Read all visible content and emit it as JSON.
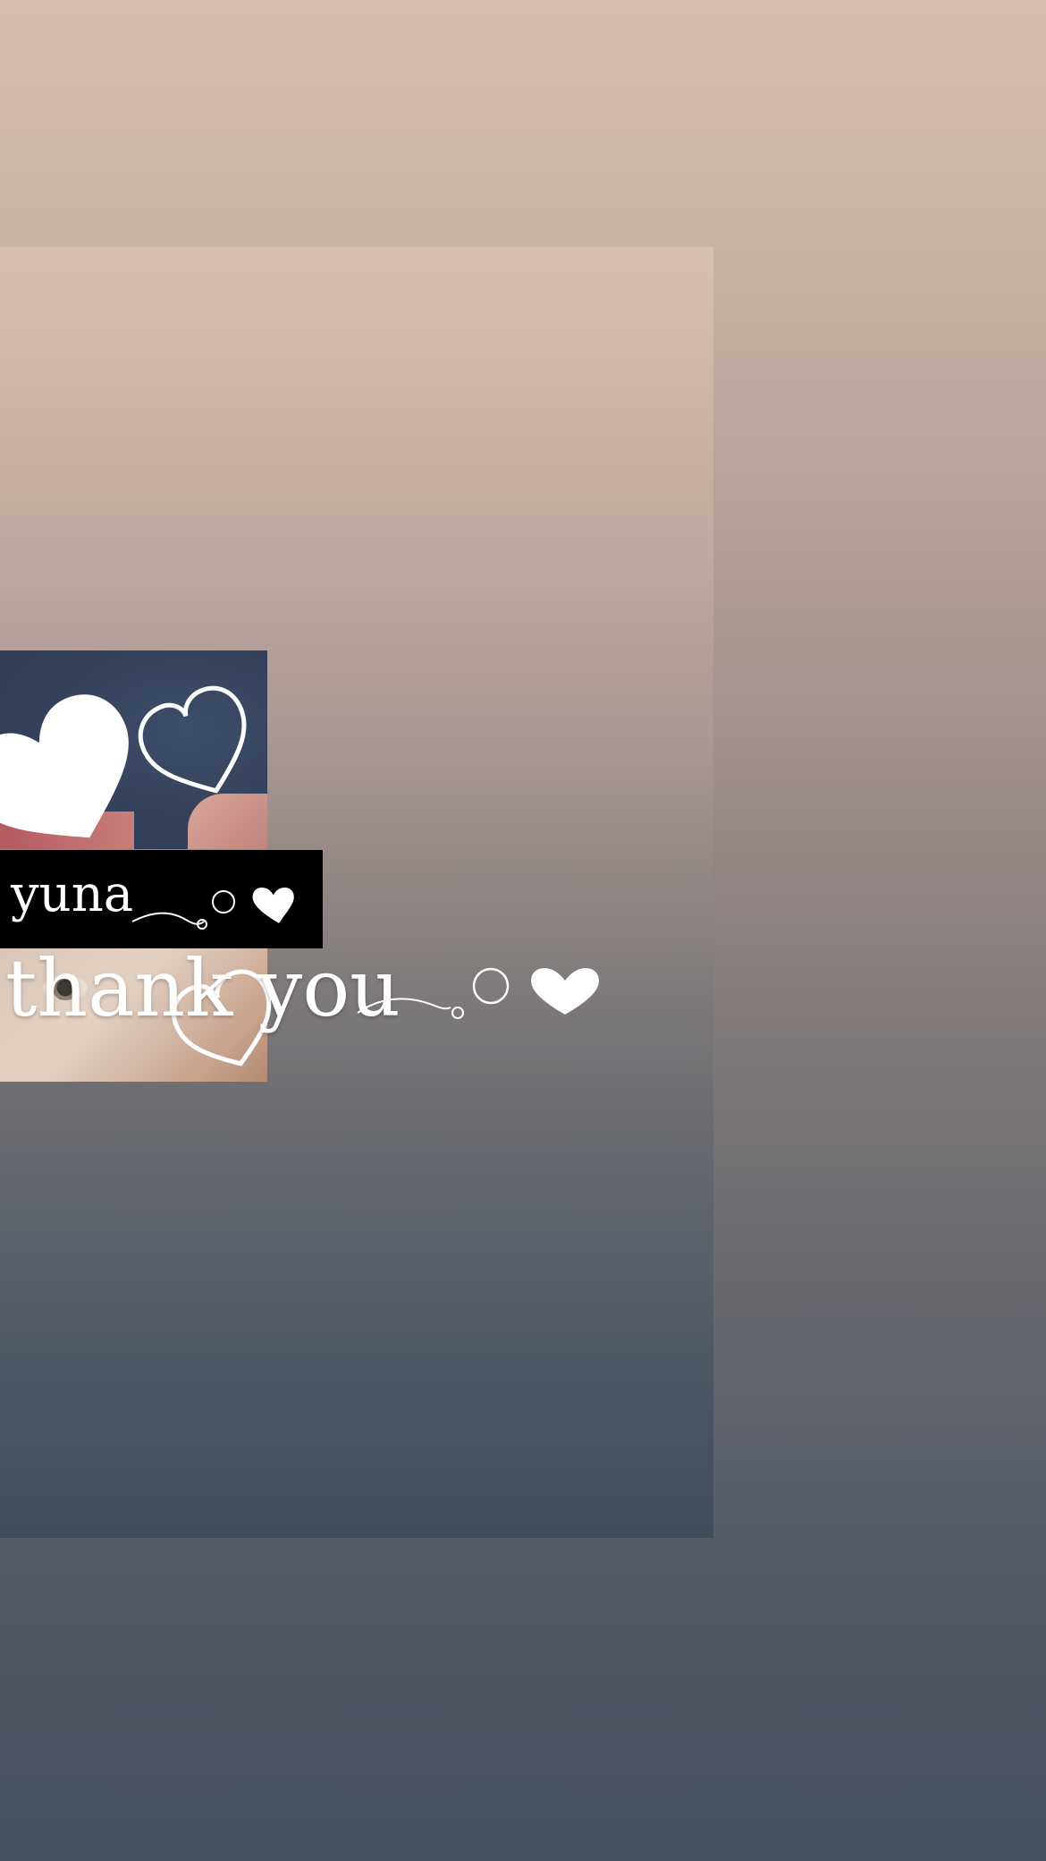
{
  "sticker": {
    "name_text": "yuna",
    "thanks_text": "thank you",
    "icons": [
      "heart-icon",
      "heart-outline-icon",
      "bubble-dots-icon",
      "swirl-tail-icon"
    ]
  },
  "colors": {
    "gradient_top": "#d8bdb0",
    "gradient_bottom": "#454f5c",
    "name_bar": "#000000",
    "text": "#ffffff"
  }
}
